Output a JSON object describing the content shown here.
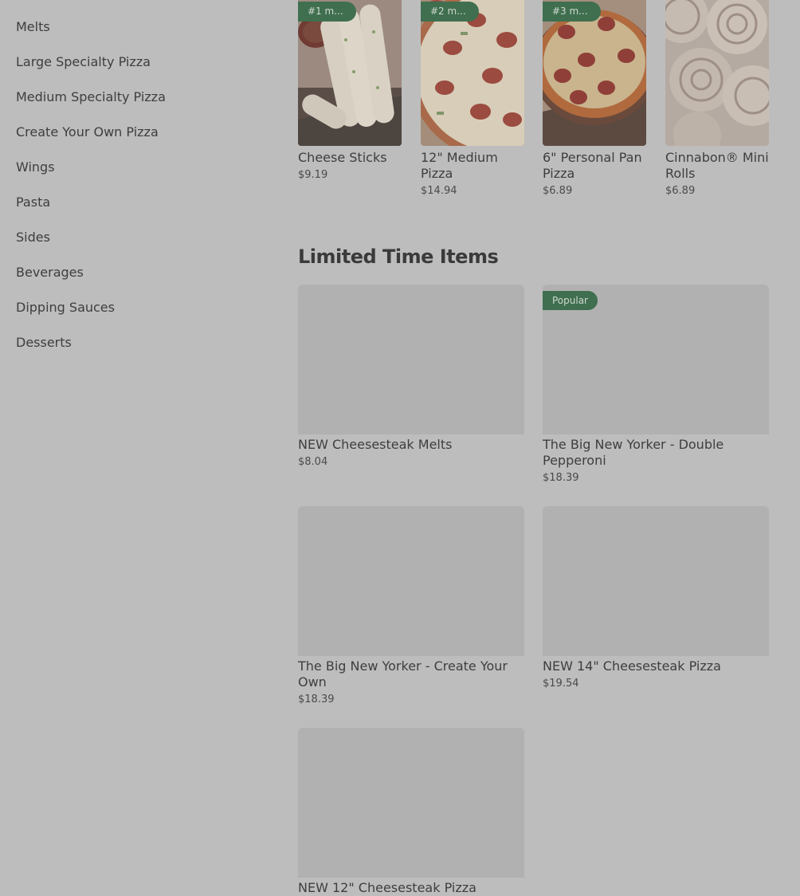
{
  "sidebar": {
    "items": [
      {
        "label": "Melts"
      },
      {
        "label": "Large Specialty Pizza"
      },
      {
        "label": "Medium Specialty Pizza"
      },
      {
        "label": "Create Your Own Pizza"
      },
      {
        "label": "Wings"
      },
      {
        "label": "Pasta"
      },
      {
        "label": "Sides"
      },
      {
        "label": "Beverages"
      },
      {
        "label": "Dipping Sauces"
      },
      {
        "label": "Desserts"
      }
    ]
  },
  "popular": {
    "items": [
      {
        "badge": "#1 m...",
        "name": "Cheese Sticks",
        "price": "$9.19"
      },
      {
        "badge": "#2 m...",
        "name": "12\" Medium Pizza",
        "price": "$14.94"
      },
      {
        "badge": "#3 m...",
        "name": "6\" Personal Pan Pizza",
        "price": "$6.89"
      },
      {
        "badge": "",
        "name": "Cinnabon® Mini Rolls",
        "price": "$6.89"
      }
    ]
  },
  "limited": {
    "title": "Limited Time Items",
    "items": [
      {
        "badge": "",
        "name": "NEW Cheesesteak Melts",
        "price": "$8.04"
      },
      {
        "badge": "Popular",
        "name": "The Big New Yorker - Double Pepperoni",
        "price": "$18.39"
      },
      {
        "badge": "",
        "name": "The Big New Yorker - Create Your Own",
        "price": "$18.39"
      },
      {
        "badge": "",
        "name": "NEW 14\" Cheesesteak Pizza",
        "price": "$19.54"
      },
      {
        "badge": "",
        "name": "NEW 12\" Cheesesteak Pizza",
        "price": ""
      }
    ]
  }
}
